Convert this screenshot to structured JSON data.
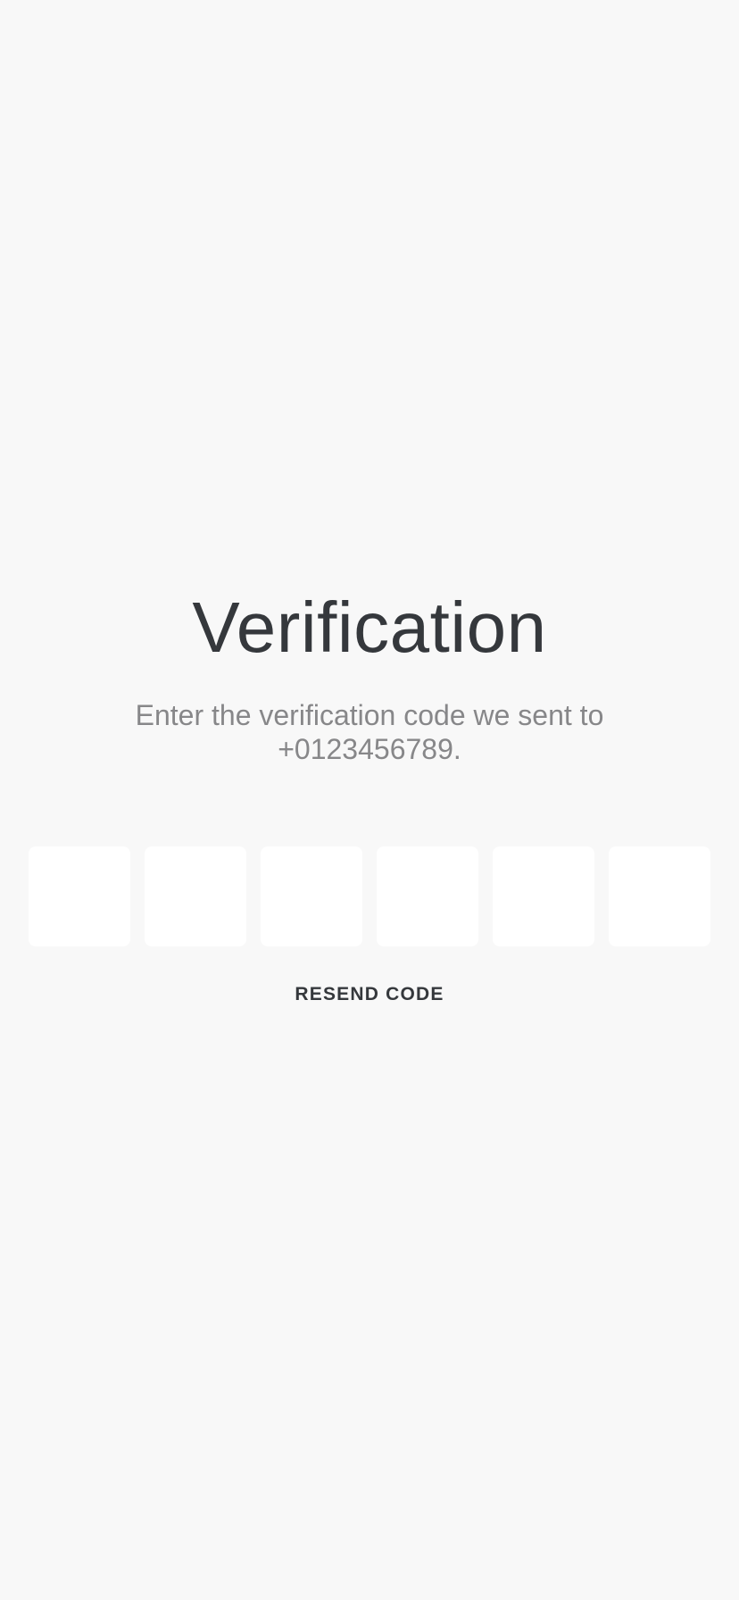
{
  "verification": {
    "title": "Verification",
    "subtitle": "Enter the verification code we sent to +0123456789.",
    "code_digits": [
      "",
      "",
      "",
      "",
      "",
      ""
    ],
    "resend_label": "RESEND CODE"
  },
  "colors": {
    "background": "#f8f8f8",
    "title": "#35383c",
    "subtitle": "#878789",
    "code_box": "#ffffff"
  }
}
